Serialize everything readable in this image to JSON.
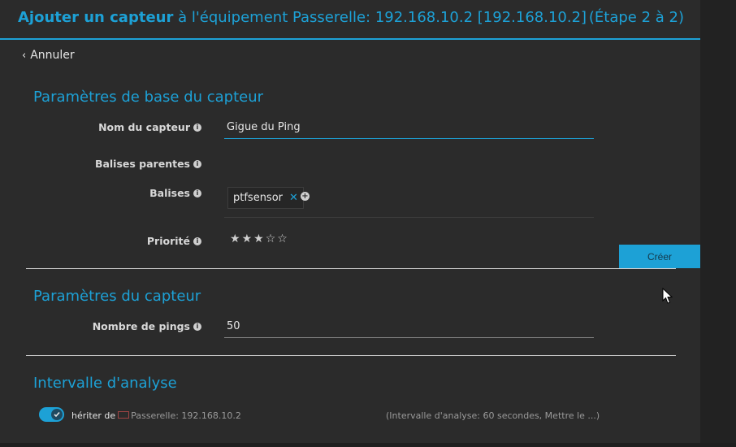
{
  "header": {
    "title_bold": "Ajouter un capteur",
    "title_rest": " à l'équipement Passerelle: 192.168.10.2 [192.168.10.2]",
    "step": "(Étape 2 à 2)"
  },
  "cancel": {
    "label": "Annuler"
  },
  "sections": {
    "basic": {
      "title": "Paramètres de base du capteur",
      "name_label": "Nom du capteur",
      "name_value": "Gigue du Ping",
      "parent_tags_label": "Balises parentes",
      "tags_label": "Balises",
      "tags": [
        "ptfsensor"
      ],
      "priority_label": "Priorité",
      "priority": 3,
      "priority_max": 5
    },
    "sensor": {
      "title": "Paramètres du capteur",
      "pings_label": "Nombre de pings",
      "pings_value": "50"
    },
    "interval": {
      "title": "Intervalle d'analyse",
      "inherit_label": "hériter de",
      "device": "Passerelle: 192.168.10.2",
      "note": "(Intervalle d'analyse: 60 secondes, Mettre le ...)",
      "inherit_enabled": true
    }
  },
  "actions": {
    "create_label": "Créer"
  },
  "colors": {
    "accent": "#1da1d6",
    "background": "#2b2b2b"
  }
}
